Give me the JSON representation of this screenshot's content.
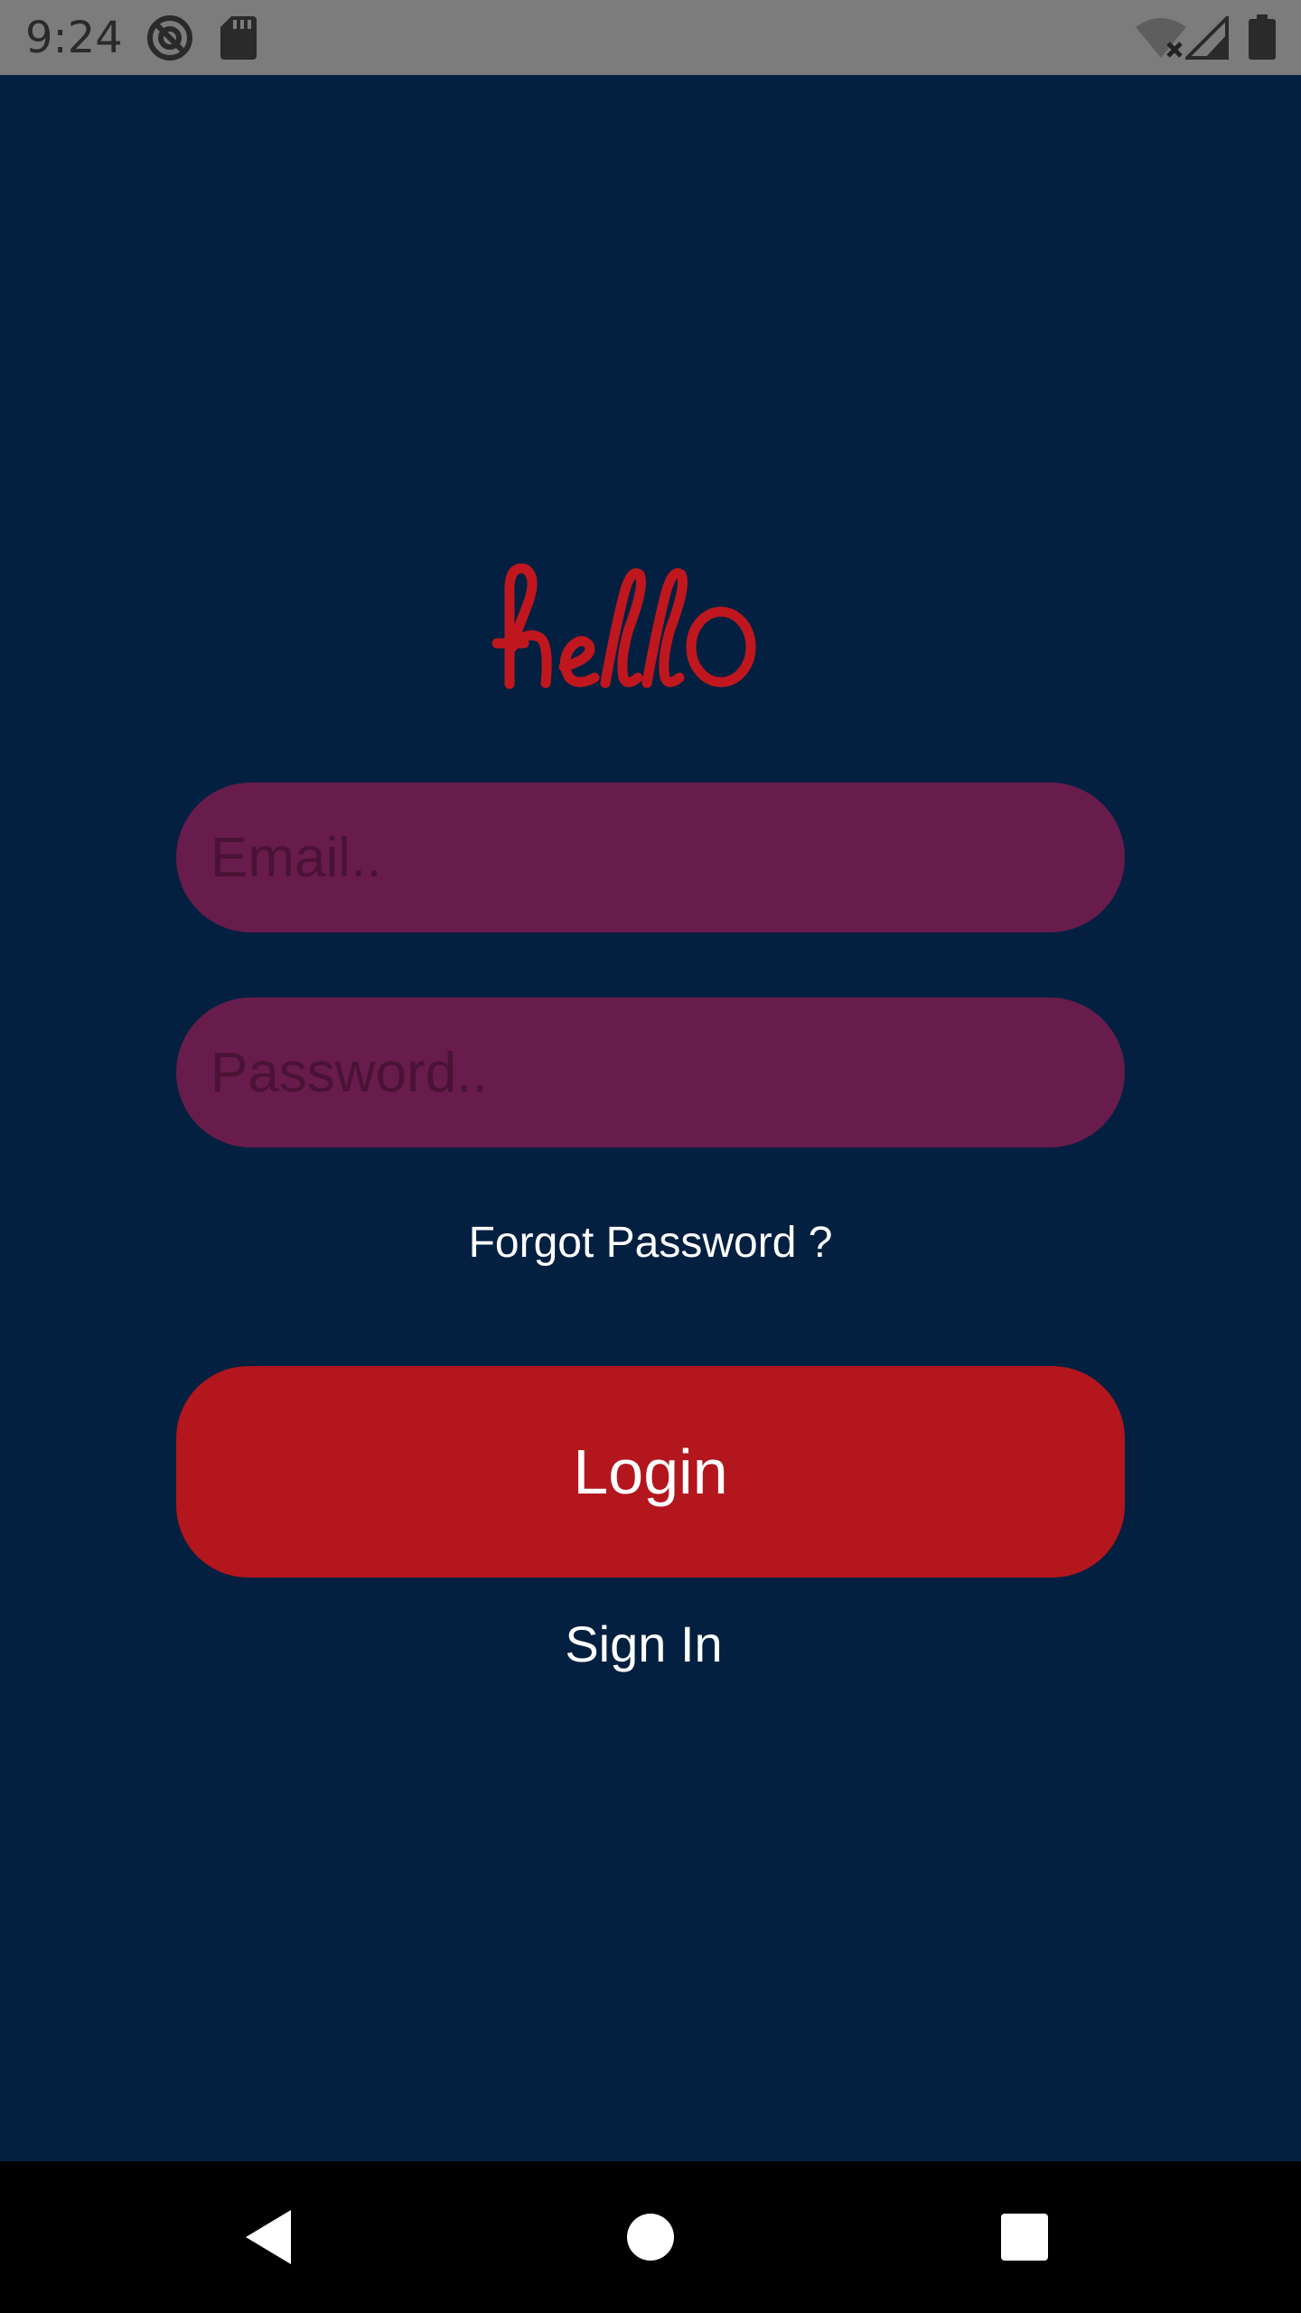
{
  "status_bar": {
    "time": "9:24",
    "icons": [
      "do-not-disturb-icon",
      "sd-card-icon",
      "wifi-off-icon",
      "cell-signal-icon",
      "battery-icon"
    ]
  },
  "logo": {
    "text": "hello",
    "color": "#c0171f"
  },
  "form": {
    "email_placeholder": "Email..",
    "password_placeholder": "Password..",
    "forgot_label": "Forgot Password ?",
    "login_label": "Login",
    "signin_label": "Sign In"
  },
  "colors": {
    "background": "#042040",
    "input_fill": "#681c4c",
    "login_fill": "#b3161d",
    "text": "#ffffff"
  },
  "nav_bar": {
    "buttons": [
      "back-icon",
      "home-icon",
      "recents-icon"
    ]
  }
}
